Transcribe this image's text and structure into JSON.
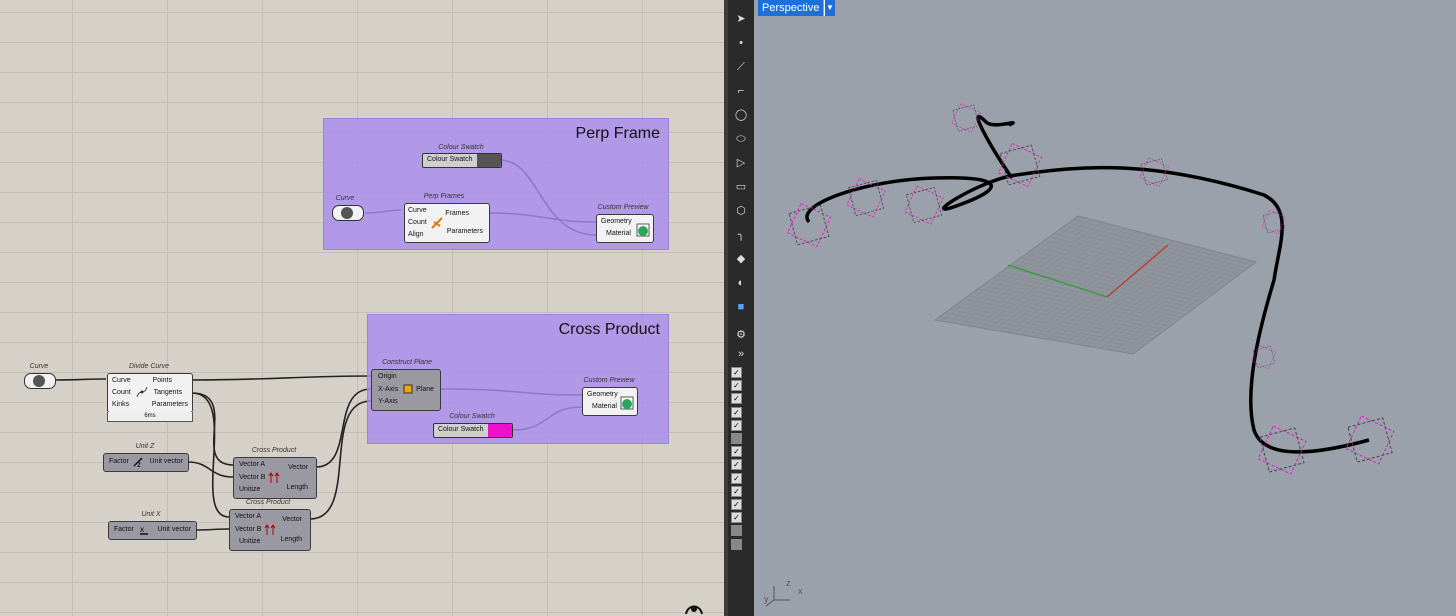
{
  "groups": {
    "perp_frame": {
      "title": "Perp Frame"
    },
    "cross_product": {
      "title": "Cross Product"
    }
  },
  "components": {
    "curve_top": {
      "caption": "Curve"
    },
    "colour_swatch_top": {
      "caption": "Colour Swatch",
      "label": "Colour Swatch",
      "color": "#555555"
    },
    "perp_frames": {
      "caption": "Perp Frames",
      "inputs": [
        "Curve",
        "Count",
        "Align"
      ],
      "outputs": [
        "Frames",
        "Parameters"
      ]
    },
    "custom_preview_top": {
      "caption": "Custom Preview",
      "inputs": [
        "Geometry",
        "Material"
      ]
    },
    "curve_bottom": {
      "caption": "Curve"
    },
    "divide_curve": {
      "caption": "Divide Curve",
      "inputs": [
        "Curve",
        "Count",
        "Kinks"
      ],
      "outputs": [
        "Points",
        "Tangents",
        "Parameters"
      ],
      "timing": "6ms"
    },
    "construct_plane": {
      "caption": "Construct Plane",
      "inputs": [
        "Origin",
        "X-Axis",
        "Y-Axis"
      ],
      "outputs": [
        "Plane"
      ]
    },
    "custom_preview_bottom": {
      "caption": "Custom Preview",
      "inputs": [
        "Geometry",
        "Material"
      ]
    },
    "colour_swatch_bottom": {
      "caption": "Colour Swatch",
      "label": "Colour Swatch",
      "color": "#ee11cc"
    },
    "unit_z": {
      "caption": "Unit Z",
      "inputs": [
        "Factor"
      ],
      "outputs": [
        "Unit vector"
      ]
    },
    "cross_product_1": {
      "caption": "Cross Product",
      "inputs": [
        "Vector A",
        "Vector B",
        "Unitize"
      ],
      "outputs": [
        "Vector",
        "Length"
      ]
    },
    "unit_x": {
      "caption": "Unit X",
      "inputs": [
        "Factor"
      ],
      "outputs": [
        "Unit vector"
      ]
    },
    "cross_product_2": {
      "caption": "Cross Product",
      "inputs": [
        "Vector A",
        "Vector B",
        "Unitize"
      ],
      "outputs": [
        "Vector",
        "Length"
      ]
    }
  },
  "viewport": {
    "name": "Perspective",
    "axes": {
      "x": "x",
      "y": "y",
      "z": "z"
    },
    "colors": {
      "background": "#9aa1aa",
      "curve": "#000000",
      "frames": "#ee11cc",
      "grid": "#8a8f96"
    }
  },
  "toolbar": {
    "tools": [
      "select-arrow-icon",
      "point-icon",
      "polyline-icon",
      "curve-icon",
      "circle-icon",
      "ellipse-icon",
      "polygon-icon",
      "rectangle-icon",
      "solid-icon",
      "fillet-icon",
      "transform-icon",
      "boolean-icon",
      "box-icon",
      "settings-icon",
      "expand-icon"
    ],
    "layer_checks": [
      true,
      true,
      true,
      true,
      true,
      false,
      true,
      true,
      true,
      true,
      true,
      true,
      false,
      false
    ]
  }
}
